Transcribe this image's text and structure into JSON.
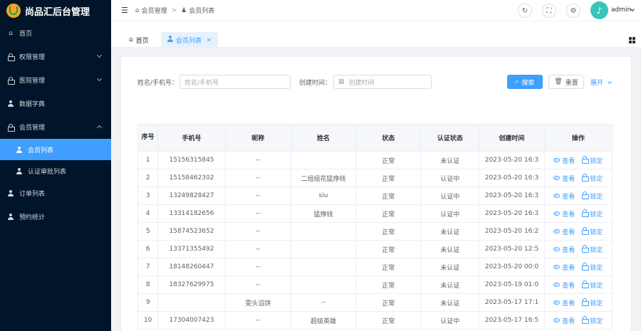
{
  "app": {
    "title": "尚品汇后台管理"
  },
  "sidebar": {
    "items": [
      {
        "label": "首页",
        "icon": "home-icon"
      },
      {
        "label": "权限管理",
        "icon": "lock-icon",
        "expandable": true
      },
      {
        "label": "医院管理",
        "icon": "lock-icon",
        "expandable": true
      },
      {
        "label": "数据字典",
        "icon": "user-icon"
      },
      {
        "label": "会员管理",
        "icon": "lock-icon",
        "expandable": true,
        "expanded": true
      },
      {
        "label": "会员列表",
        "icon": "user-icon",
        "sub": true,
        "active": true
      },
      {
        "label": "认证审批列表",
        "icon": "user-icon",
        "sub": true
      },
      {
        "label": "订单列表",
        "icon": "user-icon"
      },
      {
        "label": "预约统计",
        "icon": "user-icon"
      }
    ]
  },
  "header": {
    "breadcrumb": [
      "会员管理",
      "会员列表"
    ],
    "user": "admin"
  },
  "tabs": [
    {
      "label": "首页"
    },
    {
      "label": "会员列表",
      "active": true
    }
  ],
  "search": {
    "name_label": "姓名/手机号：",
    "name_placeholder": "姓名/手机号",
    "time_label": "创建时间：",
    "time_placeholder": "创建时间",
    "search_button": "搜索",
    "reset_button": "重置",
    "expand_link": "展开"
  },
  "table": {
    "columns": [
      "序号",
      "手机号",
      "昵称",
      "姓名",
      "状态",
      "认证状态",
      "创建时间",
      "操作"
    ],
    "view_label": "查看",
    "lock_label": "锁定",
    "rows": [
      {
        "idx": "1",
        "phone": "15156315845",
        "nick": "--",
        "name": "",
        "status": "正常",
        "auth": "未认证",
        "time": "2023-05-20 16:3"
      },
      {
        "idx": "2",
        "phone": "15158462302",
        "nick": "--",
        "name": "二组组花猛挣钱",
        "status": "正常",
        "auth": "认证中",
        "time": "2023-05-20 16:3"
      },
      {
        "idx": "3",
        "phone": "13249828427",
        "nick": "--",
        "name": "siu",
        "status": "正常",
        "auth": "认证中",
        "time": "2023-05-20 16:3"
      },
      {
        "idx": "4",
        "phone": "13314182656",
        "nick": "--",
        "name": "猛挣钱",
        "status": "正常",
        "auth": "认证中",
        "time": "2023-05-20 16:3"
      },
      {
        "idx": "5",
        "phone": "15874523652",
        "nick": "--",
        "name": "",
        "status": "正常",
        "auth": "未认证",
        "time": "2023-05-20 16:2"
      },
      {
        "idx": "6",
        "phone": "13371355492",
        "nick": "--",
        "name": "",
        "status": "正常",
        "auth": "未认证",
        "time": "2023-05-20 12:5"
      },
      {
        "idx": "7",
        "phone": "18148260447",
        "nick": "--",
        "name": "",
        "status": "正常",
        "auth": "未认证",
        "time": "2023-05-20 00:0"
      },
      {
        "idx": "8",
        "phone": "18327629975",
        "nick": "--",
        "name": "",
        "status": "正常",
        "auth": "未认证",
        "time": "2023-05-19 01:0"
      },
      {
        "idx": "9",
        "phone": "",
        "nick": "雯头滔饼",
        "name": "--",
        "status": "正常",
        "auth": "未认证",
        "time": "2023-05-17 17:1"
      },
      {
        "idx": "10",
        "phone": "17304007423",
        "nick": "--",
        "name": "超级英雄",
        "status": "正常",
        "auth": "认证中",
        "time": "2023-05-17 16:5"
      }
    ]
  },
  "colors": {
    "accent": "#409eff",
    "sidebar_bg": "#001529"
  }
}
